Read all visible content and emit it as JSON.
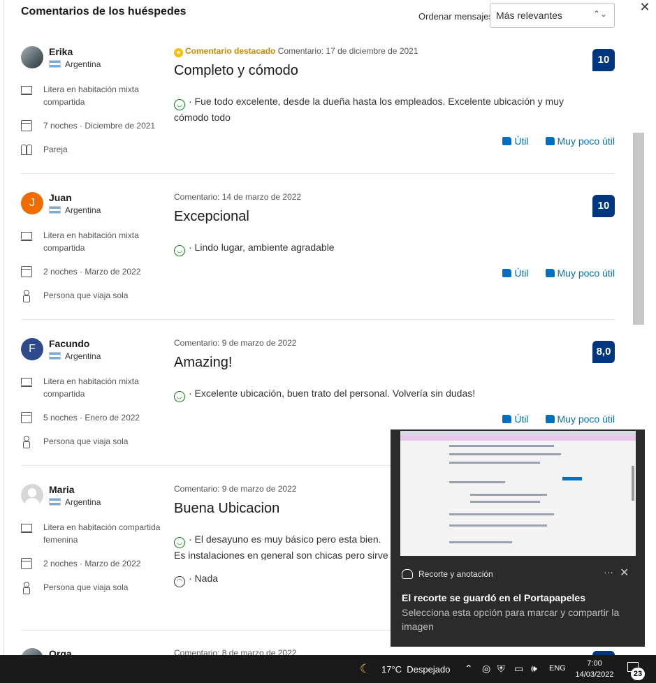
{
  "header": {
    "title": "Comentarios de los huéspedes",
    "sort_label": "Ordenar mensajes:",
    "sort_value": "Más relevantes"
  },
  "reviews": [
    {
      "name": "Erika",
      "country": "Argentina",
      "room": "Litera en habitación mixta compartida",
      "stay": "7 noches · Diciembre de 2021",
      "traveler": "Pareja",
      "featured_label": "Comentario destacado",
      "date": "Comentario: 17 de diciembre de 2021",
      "title": "Completo y cómodo",
      "score": "10",
      "positive": "· Fue todo excelente, desde la dueña hasta los empleados. Excelente ubicación y muy cómodo todo",
      "negative": "",
      "helpful": "Útil",
      "not_helpful": "Muy poco útil"
    },
    {
      "name": "Juan",
      "avatar_letter": "J",
      "country": "Argentina",
      "room": "Litera en habitación mixta compartida",
      "stay": "2 noches · Marzo de 2022",
      "traveler": "Persona que viaja sola",
      "date": "Comentario: 14 de marzo de 2022",
      "title": "Excepcional",
      "score": "10",
      "positive": "· Lindo lugar, ambiente agradable",
      "helpful": "Útil",
      "not_helpful": "Muy poco útil"
    },
    {
      "name": "Facundo",
      "avatar_letter": "F",
      "country": "Argentina",
      "room": "Litera en habitación mixta compartida",
      "stay": "5 noches · Enero de 2022",
      "traveler": "Persona que viaja sola",
      "date": "Comentario: 9 de marzo de 2022",
      "title": "Amazing!",
      "score": "8,0",
      "positive": "· Excelente ubicación, buen trato del personal. Volvería sin dudas!",
      "helpful": "Útil",
      "not_helpful": "Muy poco útil"
    },
    {
      "name": "Maria",
      "country": "Argentina",
      "room": "Litera en habitación compartida femenina",
      "stay": "2 noches · Marzo de 2022",
      "traveler": "Persona que viaja sola",
      "date": "Comentario: 9 de marzo de 2022",
      "title": "Buena Ubicacion",
      "positive": "· El desayuno es muy básico pero esta bien. Es instalaciones en general son chicas pero sirve para",
      "negative": "· Nada"
    },
    {
      "name": "Orga",
      "date": "Comentario: 8 de marzo de 2022"
    }
  ],
  "toast": {
    "app": "Recorte y anotación",
    "more": "···",
    "close": "✕",
    "title": "El recorte se guardó en el Portapapeles",
    "body": "Selecciona esta opción para marcar y compartir la imagen"
  },
  "taskbar": {
    "weather_temp": "17°C",
    "weather_desc": "Despejado",
    "language": "ENG",
    "time": "7:00",
    "date": "14/03/2022",
    "notification_count": "23"
  },
  "colors": {
    "score_bg": "#003580",
    "link": "#0071c2",
    "featured": "#cc8a00",
    "positive": "#008009",
    "avatar_j": "#ef6c00",
    "avatar_f": "#2e4a8b"
  }
}
